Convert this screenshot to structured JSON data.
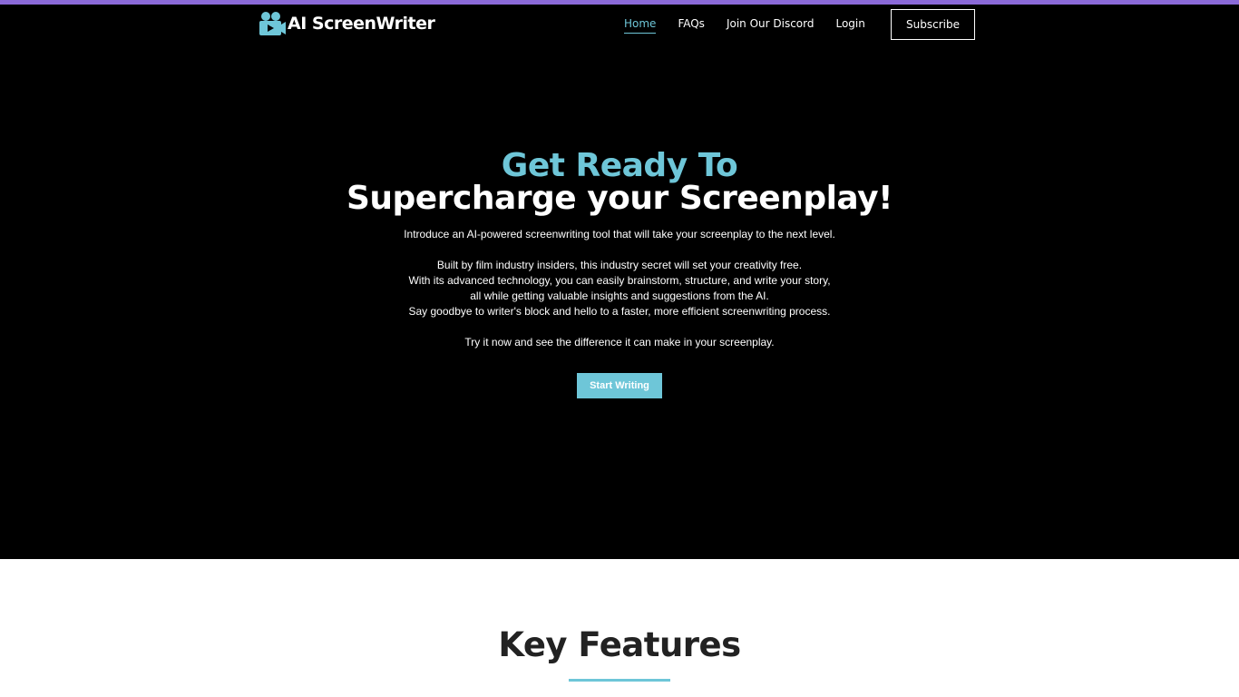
{
  "header": {
    "logo_text": "AI ScreenWriter",
    "logo_icon": "camera-icon",
    "nav": [
      {
        "label": "Home",
        "active": true
      },
      {
        "label": "FAQs",
        "active": false
      },
      {
        "label": "Join Our Discord",
        "active": false
      },
      {
        "label": "Login",
        "active": false
      }
    ],
    "subscribe_label": "Subscribe"
  },
  "hero": {
    "title_line1": "Get Ready To",
    "title_line2": "Supercharge your Screenplay!",
    "intro": "Introduce an AI-powered screenwriting tool that will take your screenplay to the next level.",
    "body_lines": [
      "Built by film industry insiders, this industry secret will set your creativity free.",
      "With its advanced technology, you can easily brainstorm, structure, and write your story,",
      "all while getting valuable insights and suggestions from the AI.",
      "Say goodbye to writer's block and hello to a faster, more efficient screenwriting process."
    ],
    "closing": "Try it now and see the difference it can make in your screenplay.",
    "cta_label": "Start Writing"
  },
  "features": {
    "title": "Key Features"
  },
  "colors": {
    "accent": "#6ec6d8",
    "top_bar": "#8b6ad8",
    "background": "#000000",
    "section_background": "#ffffff"
  }
}
